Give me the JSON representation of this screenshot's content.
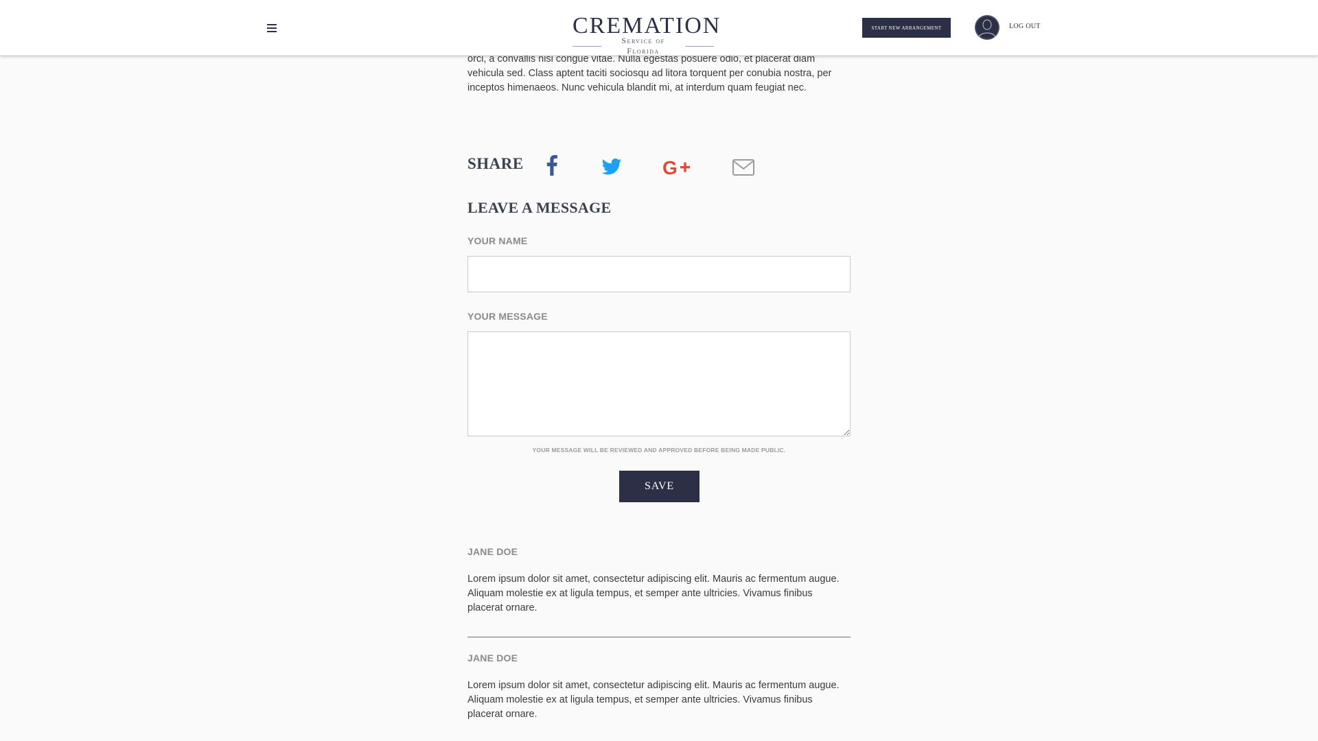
{
  "header": {
    "menu_icon": "hamburger-menu-icon",
    "logo_title": "CREMATION",
    "logo_subtitle": "Service of Florida",
    "start_button_label": "START NEW ARRANGEMENT",
    "avatar_icon": "user-avatar-icon",
    "logout_label": "LOG OUT"
  },
  "intro": {
    "text": "orci, a convallis nisi congue vitae. Nulla egestas posuere odio, et placerat diam vehicula sed. Class aptent taciti sociosqu ad litora torquent per conubia nostra, per inceptos himenaeos. Nunc vehicula blandit mi, at interdum quam feugiat nec."
  },
  "share": {
    "label": "SHARE",
    "icons": [
      "facebook-icon",
      "twitter-icon",
      "google-plus-icon",
      "email-icon"
    ]
  },
  "form": {
    "heading": "LEAVE A MESSAGE",
    "name_label": "YOUR NAME",
    "name_value": "",
    "message_label": "YOUR MESSAGE",
    "message_value": "",
    "notice": "YOUR MESSAGE WILL BE REVIEWED AND APPROVED BEFORE BEING MADE PUBLIC.",
    "save_label": "SAVE"
  },
  "comments": [
    {
      "author": "JANE DOE",
      "text": "Lorem ipsum dolor sit amet, consectetur adipiscing elit. Mauris ac fermentum augue. Aliquam molestie ex at ligula tempus, et semper ante ultricies. Vivamus finibus placerat ornare."
    },
    {
      "author": "JANE DOE",
      "text": "Lorem ipsum dolor sit amet, consectetur adipiscing elit. Mauris ac fermentum augue. Aliquam molestie ex at ligula tempus, et semper ante ultricies. Vivamus finibus placerat ornare."
    }
  ],
  "colors": {
    "brand_navy": "#2b3047",
    "facebook": "#3b5998",
    "twitter": "#1da1f2",
    "google_plus": "#dd4b39",
    "email": "#9a9a9a"
  }
}
